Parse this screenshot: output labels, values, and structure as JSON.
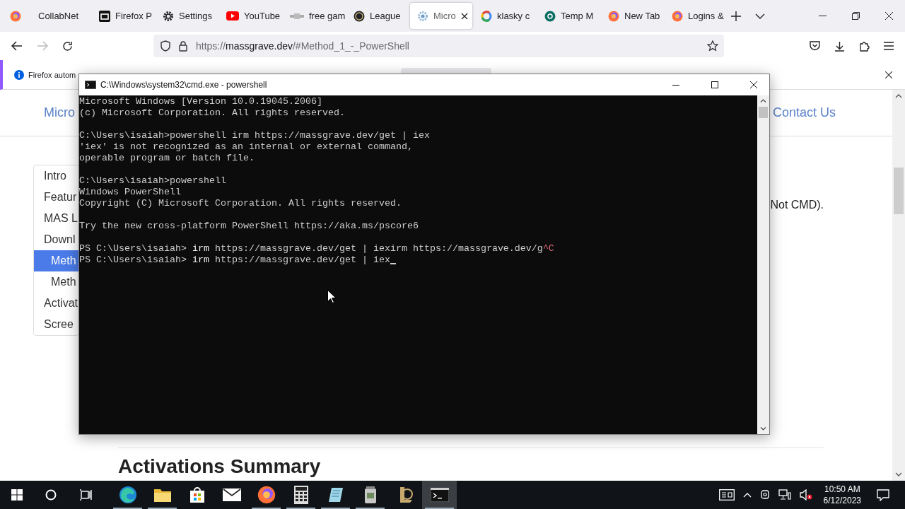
{
  "browser": {
    "tabs": [
      {
        "label": "CollabNet",
        "selected": false
      },
      {
        "label": "Firefox P",
        "selected": false
      },
      {
        "label": "Settings",
        "selected": false
      },
      {
        "label": "YouTube",
        "selected": false
      },
      {
        "label": "free gam",
        "selected": false
      },
      {
        "label": "League",
        "selected": false
      },
      {
        "label": "Micro",
        "selected": true
      },
      {
        "label": "klasky c",
        "selected": false
      },
      {
        "label": "Temp M",
        "selected": false
      },
      {
        "label": "New Tab",
        "selected": false
      },
      {
        "label": "Logins &",
        "selected": false
      }
    ],
    "address": {
      "scheme": "https://",
      "host": "massgrave.dev",
      "path": "/#Method_1_-_PowerShell"
    },
    "notification": {
      "text": "Firefox autom"
    },
    "page": {
      "header_left": "Micro",
      "header_link": "Contact Us",
      "sidebar": [
        {
          "label": "Intro",
          "selected": false
        },
        {
          "label": "Featur",
          "selected": false
        },
        {
          "label": "MAS L",
          "selected": false
        },
        {
          "label": "Downl",
          "selected": false,
          "children": [
            {
              "label": "Meth",
              "selected": true
            },
            {
              "label": "Meth",
              "selected": false
            }
          ]
        },
        {
          "label": "Activat",
          "selected": false
        },
        {
          "label": "Scree",
          "selected": false
        }
      ],
      "text_fragment": "Not CMD).",
      "heading": "Activations Summary"
    }
  },
  "cmd": {
    "title": "C:\\Windows\\system32\\cmd.exe - powershell",
    "cursor_visible": true,
    "blocks": [
      [
        {
          "kind": "text",
          "text": "Microsoft Windows [Version 10.0.19045.2006]"
        },
        {
          "kind": "text",
          "text": "(c) Microsoft Corporation. All rights reserved."
        }
      ],
      [
        {
          "kind": "text",
          "text": "C:\\Users\\isaiah>powershell irm https://massgrave.dev/get | iex"
        },
        {
          "kind": "text",
          "text": "'iex' is not recognized as an internal or external command,"
        },
        {
          "kind": "text",
          "text": "operable program or batch file."
        }
      ],
      [
        {
          "kind": "text",
          "text": "C:\\Users\\isaiah>powershell"
        },
        {
          "kind": "text",
          "text": "Windows PowerShell"
        },
        {
          "kind": "text",
          "text": "Copyright (C) Microsoft Corporation. All rights reserved."
        }
      ],
      [
        {
          "kind": "text",
          "text": "Try the new cross-platform PowerShell https://aka.ms/pscore6"
        }
      ],
      [
        {
          "kind": "ps",
          "prompt": "PS C:\\Users\\isaiah>",
          "command": "irm",
          "args": "https://massgrave.dev/get | iexirm https://massgrave.dev/g",
          "interrupt": "^C"
        },
        {
          "kind": "ps",
          "prompt": "PS C:\\Users\\isaiah>",
          "command": "irm",
          "args": "https://massgrave.dev/get | iex"
        }
      ]
    ]
  },
  "taskbar": {
    "apps": [
      {
        "running": true,
        "selected": false
      },
      {
        "running": true,
        "selected": false
      },
      {
        "running": false,
        "selected": false
      },
      {
        "running": false,
        "selected": false
      },
      {
        "running": true,
        "selected": false
      },
      {
        "running": true,
        "selected": false
      },
      {
        "running": true,
        "selected": false
      },
      {
        "running": true,
        "selected": false
      },
      {
        "running": false,
        "selected": false
      },
      {
        "running": true,
        "selected": true
      }
    ],
    "time": "10:50 AM",
    "date": "6/12/2023"
  }
}
